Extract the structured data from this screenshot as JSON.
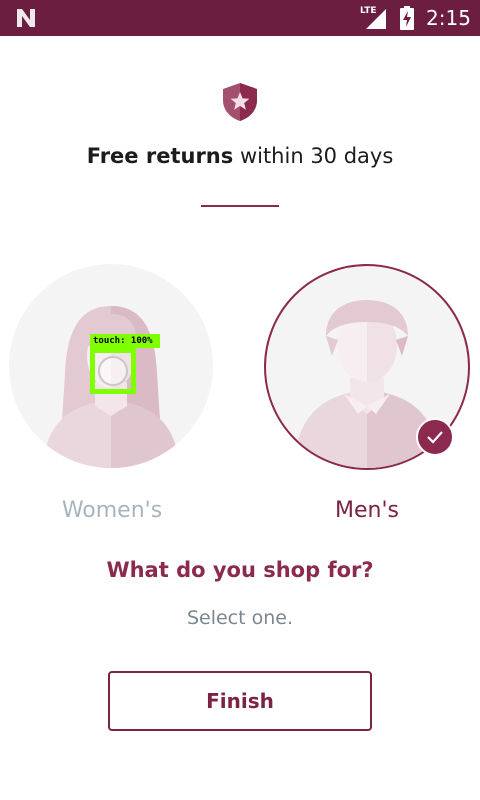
{
  "status_bar": {
    "network_label": "LTE",
    "time": "2:15",
    "background_color": "#6b1e3f",
    "icons": [
      "n-logo-icon",
      "signal-icon",
      "battery-charging-icon"
    ]
  },
  "header": {
    "icon": "shield-star-icon",
    "headline_bold": "Free returns",
    "headline_rest": " within 30 days"
  },
  "options": [
    {
      "label": "Women's",
      "selected": false,
      "icon": "woman-avatar-icon"
    },
    {
      "label": "Men's",
      "selected": true,
      "icon": "man-avatar-icon"
    }
  ],
  "prompt": {
    "question": "What do you shop for?",
    "hint": "Select one."
  },
  "actions": {
    "finish_label": "Finish"
  },
  "overlay": {
    "touch_label": "touch: 100%"
  },
  "colors": {
    "accent": "#8b2a4e",
    "unselected_label": "#a8b4bd",
    "touch_marker": "#7fff00"
  }
}
